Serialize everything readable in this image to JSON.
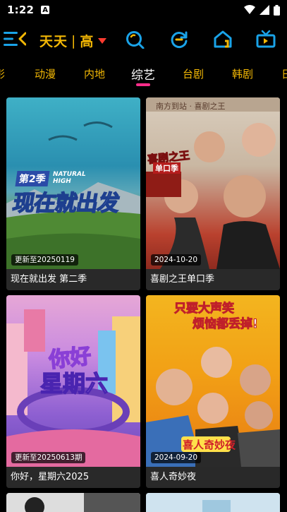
{
  "status": {
    "time": "1:22",
    "notif_letter": "A"
  },
  "toolbar": {
    "title_left": "天天",
    "title_sep": "|",
    "title_right": "高"
  },
  "tabs": [
    {
      "label": "影"
    },
    {
      "label": "动漫"
    },
    {
      "label": "内地"
    },
    {
      "label": "综艺"
    },
    {
      "label": "台剧"
    },
    {
      "label": "韩剧"
    },
    {
      "label": "日"
    }
  ],
  "active_tab": "综艺",
  "cards": [
    {
      "title": "现在就出发 第二季",
      "badge": "更新至20250119",
      "poster_text": [
        "第2季",
        "现在就出发"
      ],
      "poster_small": "NATURAL HIGH"
    },
    {
      "title": "喜剧之王单口季",
      "badge": "2024-10-20",
      "poster_text": [
        "喜剧之王",
        "单口季"
      ],
      "poster_small": "南方到站 · 喜剧之王"
    },
    {
      "title": "你好，星期六2025",
      "badge": "更新至20250613期",
      "poster_text": [
        "你好",
        "星期六"
      ],
      "poster_small": ""
    },
    {
      "title": "喜人奇妙夜",
      "badge": "2024-09-20",
      "poster_text": [
        "只要大声笑",
        "烦恼都丢掉!"
      ],
      "poster_small": "喜人奇妙夜"
    }
  ],
  "colors": {
    "accent_yellow": "#f2b705",
    "icon_blue": "#1aa3e8",
    "tab_underline": "#ff2d8a"
  }
}
